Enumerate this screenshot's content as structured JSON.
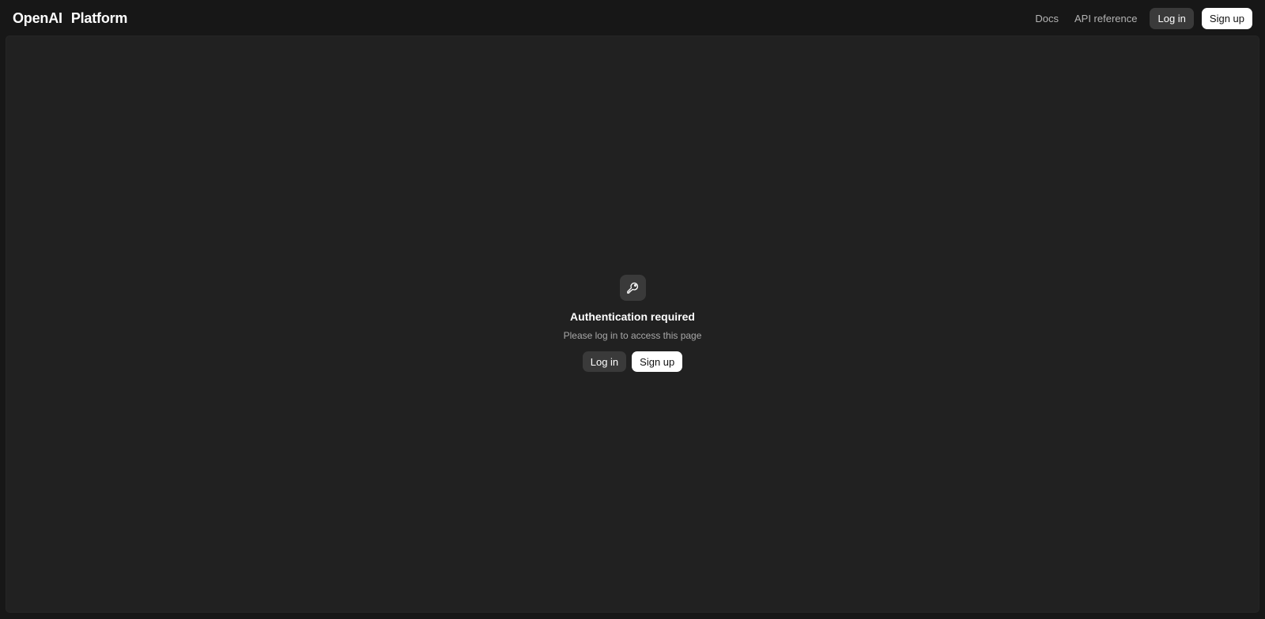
{
  "header": {
    "brand": "OpenAI",
    "product": "Platform",
    "nav": {
      "docs": "Docs",
      "api_reference": "API reference"
    },
    "login_label": "Log in",
    "signup_label": "Sign up"
  },
  "auth": {
    "icon": "key-icon",
    "title": "Authentication required",
    "subtitle": "Please log in to access this page",
    "login_label": "Log in",
    "signup_label": "Sign up"
  },
  "colors": {
    "page_bg": "#171717",
    "panel_bg": "#212121",
    "dark_button": "#3a3a3a",
    "light_button": "#ffffff"
  }
}
